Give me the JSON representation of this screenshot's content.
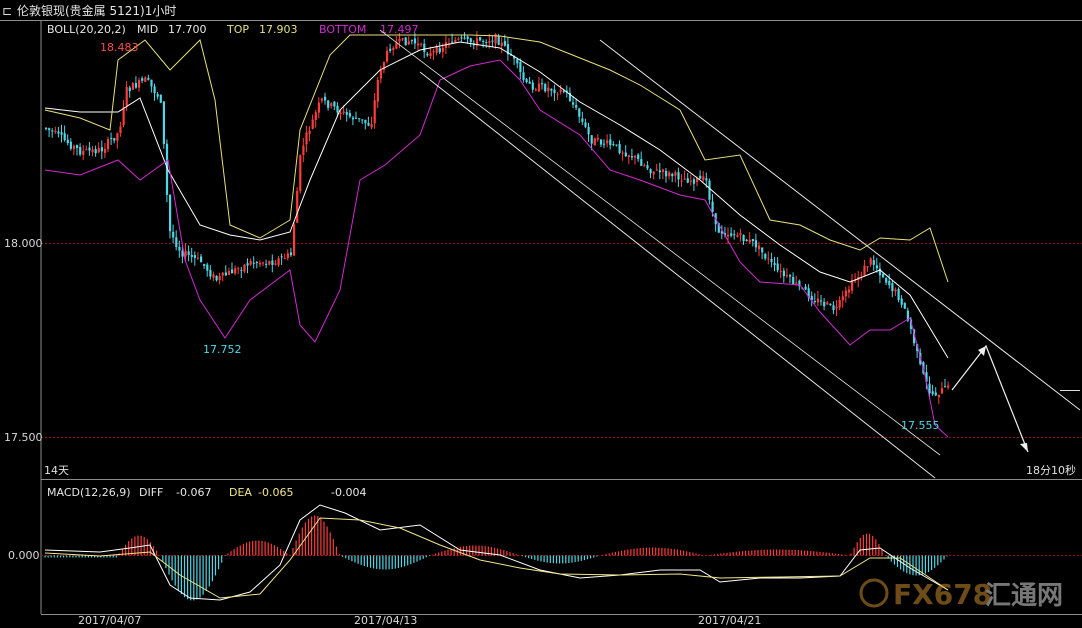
{
  "window": {
    "title": "伦敦银现(贵金属 5121)1小时",
    "icon": "back-arrow-icon"
  },
  "main_panel": {
    "indicator": "BOLL(20,20,2)",
    "mid_label": "MID",
    "mid_value": "17.700",
    "top_label": "TOP",
    "top_value": "17.903",
    "bottom_label": "BOTTOM",
    "bottom_value": "17.497",
    "y_ticks": [
      "18.000",
      "17.500"
    ],
    "period_label": "14天",
    "countdown": "18分10秒",
    "annotations": {
      "high": "18.483",
      "low1": "17.752",
      "low2": "17.555"
    }
  },
  "macd_panel": {
    "indicator": "MACD(12,26,9)",
    "diff_label": "DIFF",
    "diff_value": "-0.067",
    "dea_label": "DEA",
    "dea_value": "-0.065",
    "macd_value": "-0.004",
    "zero_label": "0.000"
  },
  "x_axis": {
    "dates": [
      "2017/04/07",
      "2017/04/13",
      "2017/04/21"
    ]
  },
  "watermark": {
    "text": "FX678",
    "chinese": "汇通网"
  },
  "colors": {
    "background": "#000000",
    "up": "#ff3c3c",
    "down": "#4ed7e6",
    "mid": "#ffffff",
    "top": "#e8e07a",
    "bottom": "#d22ad2",
    "grid": "#8b0000",
    "diff": "#ffffff",
    "dea": "#f1e68a"
  },
  "chart_data": [
    {
      "type": "candlestick",
      "title": "伦敦银现(贵金属 5121)1小时",
      "series": [
        {
          "name": "MID",
          "last": 17.7
        },
        {
          "name": "TOP",
          "last": 17.903
        },
        {
          "name": "BOTTOM",
          "last": 17.497
        }
      ],
      "y_ticks": [
        18.0,
        17.5
      ],
      "annotated_points": [
        {
          "label": "18.483",
          "value": 18.483,
          "date": "2017/04/07"
        },
        {
          "label": "17.752",
          "value": 17.752,
          "date": "2017/04/07"
        },
        {
          "label": "17.555",
          "value": 17.555,
          "date": "2017/04/21"
        }
      ]
    },
    {
      "type": "bar",
      "title": "MACD(12,26,9)",
      "series": [
        {
          "name": "DIFF",
          "last": -0.067
        },
        {
          "name": "DEA",
          "last": -0.065
        },
        {
          "name": "MACD",
          "last": -0.004
        }
      ],
      "y_ticks": [
        0.0
      ]
    }
  ]
}
